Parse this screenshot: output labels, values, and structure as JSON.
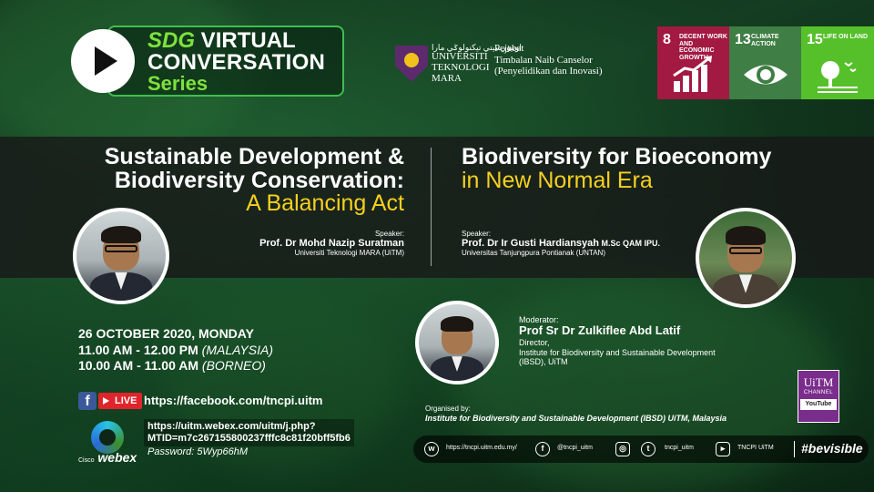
{
  "header": {
    "series_line1_green": "SDG",
    "series_line1_rest": " VIRTUAL",
    "series_line2": "CONVERSATION",
    "series_line3": "Series",
    "uitm_name": [
      "UNIVERSITI",
      "TEKNOLOGI",
      "MARA"
    ],
    "uitm_arabic": "اونيۏرسيتي تيكنولوݢي مارا",
    "office": [
      "Pejabat",
      "Timbalan Naib Canselor",
      "(Penyelidikan dan Inovasi)"
    ]
  },
  "sdg_goals": [
    {
      "num": "8",
      "label": "DECENT WORK AND ECONOMIC GROWTH",
      "color": "#a21942",
      "icon": "growth-chart-icon"
    },
    {
      "num": "13",
      "label": "CLIMATE ACTION",
      "color": "#3f7e44",
      "icon": "eye-globe-icon"
    },
    {
      "num": "15",
      "label": "LIFE ON LAND",
      "color": "#56c02b",
      "icon": "tree-birds-icon"
    }
  ],
  "talks": {
    "left": {
      "title_line1": "Sustainable Development &",
      "title_line2": "Biodiversity Conservation:",
      "title_line3": "A Balancing Act",
      "speaker_label": "Speaker:",
      "speaker_name": "Prof. Dr Mohd Nazip Suratman",
      "speaker_inst": "Universiti Teknologi MARA (UiTM)"
    },
    "right": {
      "title_line1": "Biodiversity for Bioeconomy",
      "title_line2": "in New Normal Era",
      "speaker_label": "Speaker:",
      "speaker_name": "Prof. Dr Ir Gusti Hardiansyah",
      "speaker_quals": " M.Sc QAM IPU.",
      "speaker_inst": "Universitas Tanjungpura Pontianak (UNTAN)"
    }
  },
  "schedule": {
    "date": "26 OCTOBER 2020, MONDAY",
    "time1": "11.00 AM - 12.00 PM",
    "zone1": "(MALAYSIA)",
    "time2": "10.00 AM - 11.00 AM",
    "zone2": "(BORNEO)"
  },
  "moderator": {
    "label": "Moderator:",
    "name": "Prof Sr Dr Zulkiflee Abd Latif",
    "role": "Director,",
    "inst_line1": "Institute for Biodiversity and Sustainable Development",
    "inst_line2": "(IBSD), UiTM"
  },
  "links": {
    "fb_letter": "f",
    "live_label": "LIVE",
    "facebook_url": "https://facebook.com/tncpi.uitm",
    "webex_url_line1": "https://uitm.webex.com/uitm/j.php?",
    "webex_url_line2": "MTID=m7c267155800237fffc8c81f20bff5fb6",
    "password": "Password: 5Wyp66hM",
    "webex_brand_small": "Cisco",
    "webex_brand": "webex"
  },
  "organiser": {
    "label": "Organised by:",
    "name": "Institute for Biodiversity and Sustainable Development (IBSD) UiTM, Malaysia"
  },
  "channel_badge": {
    "name": "UiTM",
    "sub": "CHANNEL",
    "platform": "YouTube"
  },
  "social": {
    "web": "https://tncpi.uitm.edu.my/",
    "facebook": "@tncpi_uitm",
    "instagram_twitter": "tncpi_uitm",
    "youtube": "TNCPI UiTM",
    "hashtag": "#bevisible"
  }
}
